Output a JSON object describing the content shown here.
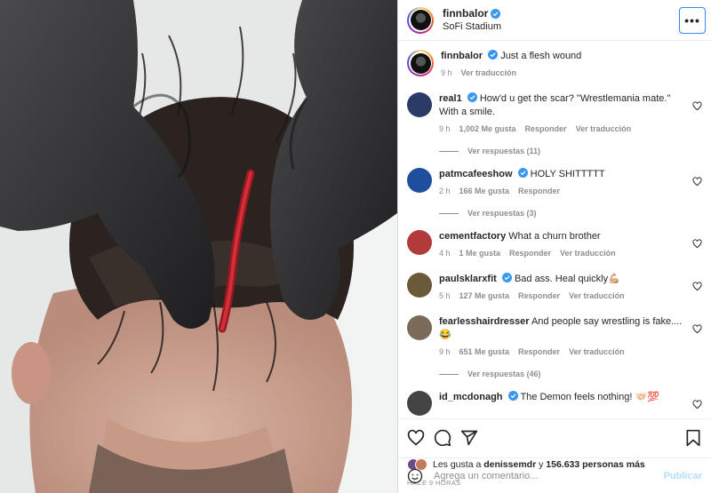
{
  "header": {
    "username": "finnbalor",
    "location": "SoFi Stadium",
    "more_label": "•••"
  },
  "caption": {
    "username": "finnbalor",
    "text": "Just a flesh wound",
    "time": "9 h",
    "translate": "Ver traducción"
  },
  "comments": [
    {
      "username": "real1",
      "verified": true,
      "text": "How'd u get the scar? \"Wrestlemania mate.\" With a smile.",
      "time": "9 h",
      "likes": "1,002 Me gusta",
      "reply": "Responder",
      "translate": "Ver traducción",
      "replies": "Ver respuestas (11)",
      "avatar_color": "#2b3a67"
    },
    {
      "username": "patmcafeeshow",
      "verified": true,
      "text": "HOLY SHITTTTT",
      "time": "2 h",
      "likes": "166 Me gusta",
      "reply": "Responder",
      "translate": "",
      "replies": "Ver respuestas (3)",
      "avatar_color": "#1f4e9c"
    },
    {
      "username": "cementfactory",
      "verified": false,
      "text": "What a churn brother",
      "time": "4 h",
      "likes": "1 Me gusta",
      "reply": "Responder",
      "translate": "Ver traducción",
      "replies": "",
      "avatar_color": "#b23a3a"
    },
    {
      "username": "paulsklarxfit",
      "verified": true,
      "text": "Bad ass. Heal quickly💪🏼",
      "time": "5 h",
      "likes": "127 Me gusta",
      "reply": "Responder",
      "translate": "Ver traducción",
      "replies": "",
      "avatar_color": "#6b5a3a"
    },
    {
      "username": "fearlesshairdresser",
      "verified": false,
      "text": "And people say wrestling is fake.... 😂",
      "time": "9 h",
      "likes": "651 Me gusta",
      "reply": "Responder",
      "translate": "Ver traducción",
      "replies": "Ver respuestas (46)",
      "avatar_color": "#7a6a5a"
    },
    {
      "username": "id_mcdonagh",
      "verified": true,
      "text": "The Demon feels nothing! 🤝🏻💯",
      "time": "",
      "likes": "",
      "reply": "",
      "translate": "",
      "replies": "",
      "avatar_color": "#444"
    }
  ],
  "likes": {
    "prefix": "Les gusta a",
    "user": "denissemdr",
    "joiner": "y",
    "count": "156.633 personas más"
  },
  "time_ago": "HACE 9 HORAS",
  "add_comment": {
    "placeholder": "Agrega un comentario...",
    "publish": "Publicar"
  },
  "icons": {
    "like": "heart-icon",
    "comment": "comment-icon",
    "share": "share-icon",
    "save": "bookmark-icon",
    "emoji": "emoji-icon",
    "verified": "verified-badge-icon"
  },
  "colors": {
    "verified": "#3897f0",
    "publish_disabled": "#b2dffc",
    "more_focus": "#3b82f6"
  }
}
